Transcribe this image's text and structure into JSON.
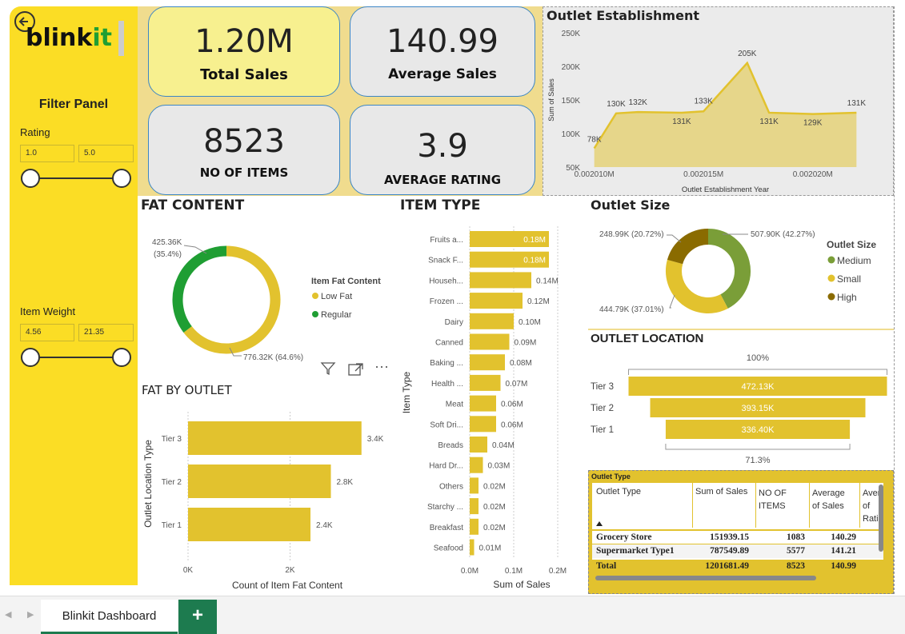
{
  "app": {
    "logo": "blinkit",
    "tab_label": "Blinkit Dashboard",
    "add_tab": "+"
  },
  "filter": {
    "title": "Filter Panel",
    "rating": {
      "label": "Rating",
      "min": "1.0",
      "max": "5.0"
    },
    "weight": {
      "label": "Item Weight",
      "min": "4.56",
      "max": "21.35"
    }
  },
  "kpis": {
    "total_sales": {
      "value": "1.20M",
      "label": "Total Sales"
    },
    "avg_sales": {
      "value": "140.99",
      "label": "Average Sales"
    },
    "items": {
      "value": "8523",
      "label": "NO OF ITEMS"
    },
    "avg_rating": {
      "value": "3.9",
      "label": "AVERAGE RATING"
    }
  },
  "colors": {
    "yellow": "#fbdd25",
    "mustard": "#e2c22e",
    "green": "#1f9e33",
    "olive": "#7a9e38",
    "dark_olive": "#8a6b00"
  },
  "chart_data": [
    {
      "id": "outlet-establishment",
      "type": "area",
      "title": "Outlet Establishment",
      "xlabel": "Outlet Establishment Year",
      "ylabel": "Sum of Sales",
      "x_ticks": [
        "0.002010M",
        "0.002015M",
        "0.002020M"
      ],
      "y_ticks": [
        "50K",
        "100K",
        "150K",
        "200K",
        "250K"
      ],
      "ylim": [
        50,
        250
      ],
      "x": [
        2010,
        2011,
        2012,
        2014,
        2015,
        2017,
        2018,
        2020,
        2022
      ],
      "values": [
        78,
        130,
        132,
        131,
        133,
        205,
        131,
        129,
        131
      ],
      "labels": [
        "78K",
        "130K",
        "132K",
        "131K",
        "133K",
        "205K",
        "131K",
        "129K",
        "131K"
      ]
    },
    {
      "id": "fat-content",
      "type": "pie",
      "title": "FAT CONTENT",
      "legend_title": "Item Fat Content",
      "slices": [
        {
          "name": "Low Fat",
          "value": 776.32,
          "label": "776.32K (64.6%)",
          "color": "#e2c22e"
        },
        {
          "name": "Regular",
          "value": 425.36,
          "label_line1": "425.36K",
          "label_line2": "(35.4%)",
          "color": "#1f9e33"
        }
      ]
    },
    {
      "id": "item-type",
      "type": "bar",
      "title": "ITEM TYPE",
      "xlabel": "Sum of Sales",
      "ylabel": "Item Type",
      "x_ticks": [
        "0.0M",
        "0.1M",
        "0.2M"
      ],
      "xlim": [
        0,
        0.2
      ],
      "categories": [
        "Fruits a...",
        "Snack F...",
        "Househ...",
        "Frozen ...",
        "Dairy",
        "Canned",
        "Baking ...",
        "Health ...",
        "Meat",
        "Soft Dri...",
        "Breads",
        "Hard Dr...",
        "Others",
        "Starchy ...",
        "Breakfast",
        "Seafood"
      ],
      "values": [
        0.18,
        0.18,
        0.14,
        0.12,
        0.1,
        0.09,
        0.08,
        0.07,
        0.06,
        0.06,
        0.04,
        0.03,
        0.02,
        0.02,
        0.02,
        0.01
      ],
      "labels": [
        "0.18M",
        "0.18M",
        "0.14M",
        "0.12M",
        "0.10M",
        "0.09M",
        "0.08M",
        "0.07M",
        "0.06M",
        "0.06M",
        "0.04M",
        "0.03M",
        "0.02M",
        "0.02M",
        "0.02M",
        "0.01M"
      ]
    },
    {
      "id": "fat-by-outlet",
      "type": "bar",
      "title": "FAT BY OUTLET",
      "xlabel": "Count of Item Fat Content",
      "ylabel": "Outlet Location Type",
      "x_ticks": [
        "0K",
        "2K"
      ],
      "xlim": [
        0,
        4
      ],
      "categories": [
        "Tier 3",
        "Tier 2",
        "Tier 1"
      ],
      "values": [
        3.4,
        2.8,
        2.4
      ],
      "labels": [
        "3.4K",
        "2.8K",
        "2.4K"
      ]
    },
    {
      "id": "outlet-size",
      "type": "pie",
      "title": "Outlet Size",
      "legend_title": "Outlet Size",
      "slices": [
        {
          "name": "Medium",
          "value": 507.9,
          "label": "507.90K (42.27%)",
          "color": "#7a9e38"
        },
        {
          "name": "Small",
          "value": 444.79,
          "label": "444.79K (37.01%)",
          "color": "#e2c22e"
        },
        {
          "name": "High",
          "value": 248.99,
          "label": "248.99K (20.72%)",
          "color": "#8a6b00"
        }
      ]
    },
    {
      "id": "outlet-location",
      "type": "bar",
      "title": "OUTLET LOCATION",
      "top_label": "100%",
      "bottom_label": "71.3%",
      "categories": [
        "Tier 3",
        "Tier 2",
        "Tier 1"
      ],
      "values": [
        472.13,
        393.15,
        336.4
      ],
      "labels": [
        "472.13K",
        "393.15K",
        "336.40K"
      ]
    }
  ],
  "outlet_table": {
    "title": "Outlet Type",
    "headers": [
      "Outlet Type",
      "Sum of Sales",
      "NO OF ITEMS",
      "Average of Sales",
      "Average of Rating"
    ],
    "header_lines": [
      [
        "Outlet Type"
      ],
      [
        "Sum of Sales"
      ],
      [
        "NO OF",
        "ITEMS"
      ],
      [
        "Average",
        "of Sales"
      ],
      [
        "Avera",
        "of",
        "Ratin"
      ]
    ],
    "rows": [
      [
        "Grocery Store",
        "151939.15",
        "1083",
        "140.29"
      ],
      [
        "Supermarket Type1",
        "787549.89",
        "5577",
        "141.21"
      ]
    ],
    "total": [
      "Total",
      "1201681.49",
      "8523",
      "140.99"
    ]
  }
}
